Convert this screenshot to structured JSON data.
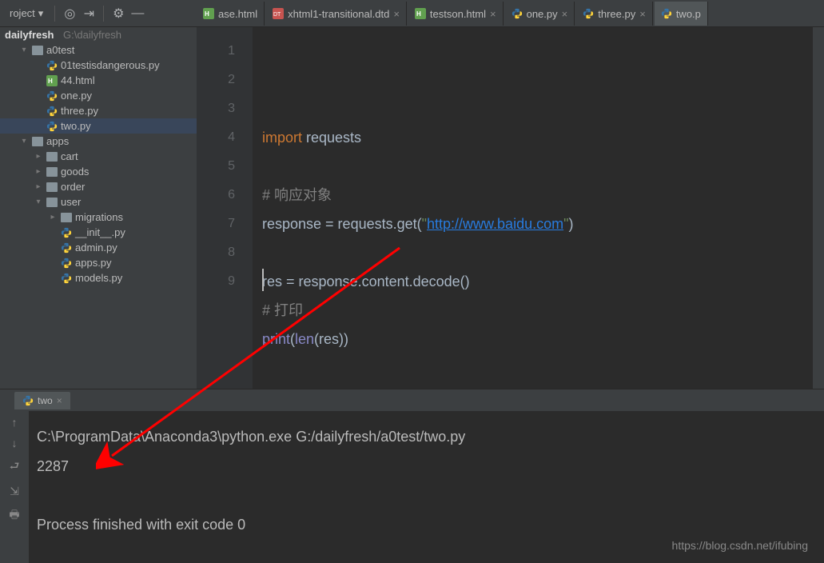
{
  "toolbar": {
    "project_label": "roject"
  },
  "tabs": [
    {
      "label": "ase.html",
      "type": "html",
      "active": false,
      "truncated": true
    },
    {
      "label": "xhtml1-transitional.dtd",
      "type": "dtd",
      "active": false
    },
    {
      "label": "testson.html",
      "type": "html",
      "active": false
    },
    {
      "label": "one.py",
      "type": "py",
      "active": false
    },
    {
      "label": "three.py",
      "type": "py",
      "active": false
    },
    {
      "label": "two.p",
      "type": "py",
      "active": true,
      "truncated": true
    }
  ],
  "tree": {
    "root_name": "dailyfresh",
    "root_path": "G:\\dailyfresh",
    "items": [
      {
        "indent": 1,
        "arrow": "▾",
        "icon": "dir",
        "label": "a0test"
      },
      {
        "indent": 2,
        "arrow": "",
        "icon": "py",
        "label": "01testisdangerous.py"
      },
      {
        "indent": 2,
        "arrow": "",
        "icon": "html",
        "label": "44.html"
      },
      {
        "indent": 2,
        "arrow": "",
        "icon": "py",
        "label": "one.py"
      },
      {
        "indent": 2,
        "arrow": "",
        "icon": "py",
        "label": "three.py"
      },
      {
        "indent": 2,
        "arrow": "",
        "icon": "py",
        "label": "two.py",
        "selected": true
      },
      {
        "indent": 1,
        "arrow": "▾",
        "icon": "dir",
        "label": "apps"
      },
      {
        "indent": 2,
        "arrow": "▸",
        "icon": "dir",
        "label": "cart"
      },
      {
        "indent": 2,
        "arrow": "▸",
        "icon": "dir",
        "label": "goods"
      },
      {
        "indent": 2,
        "arrow": "▸",
        "icon": "dir",
        "label": "order"
      },
      {
        "indent": 2,
        "arrow": "▾",
        "icon": "dir",
        "label": "user"
      },
      {
        "indent": 3,
        "arrow": "▸",
        "icon": "dir",
        "label": "migrations"
      },
      {
        "indent": 3,
        "arrow": "",
        "icon": "py",
        "label": "__init__.py"
      },
      {
        "indent": 3,
        "arrow": "",
        "icon": "py",
        "label": "admin.py"
      },
      {
        "indent": 3,
        "arrow": "",
        "icon": "py",
        "label": "apps.py"
      },
      {
        "indent": 3,
        "arrow": "",
        "icon": "py",
        "label": "models.py"
      }
    ]
  },
  "code_lines": [
    "1",
    "2",
    "3",
    "4",
    "5",
    "6",
    "7",
    "8",
    "9"
  ],
  "code": {
    "l1_kw": "import",
    "l1_rest": " requests",
    "l3_com": "# 响应对象",
    "l4_a": "response = requests.get(",
    "l4_q1": "\"",
    "l4_url": "http://www.baidu.com",
    "l4_q2": "\"",
    "l4_b": ")",
    "l6": "res = response.content.decode()",
    "l7_com": "# 打印",
    "l8_a": "print",
    "l8_b": "(",
    "l8_c": "len",
    "l8_d": "(res))"
  },
  "run_tab_label": "two",
  "console": {
    "line1": "C:\\ProgramData\\Anaconda3\\python.exe G:/dailyfresh/a0test/two.py",
    "line2": "2287",
    "line4": "Process finished with exit code 0"
  },
  "watermark": "https://blog.csdn.net/ifubing"
}
